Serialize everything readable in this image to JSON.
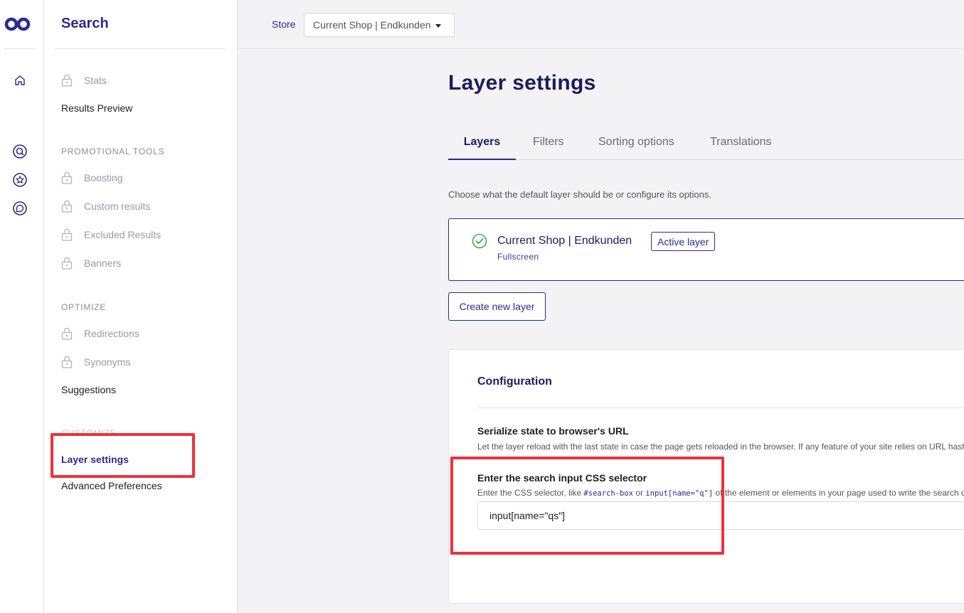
{
  "sidebar": {
    "title": "Search",
    "sections": {
      "promotional_tools": "PROMOTIONAL TOOLS",
      "optimize": "OPTIMIZE",
      "customize": "CUSTOMIZE"
    },
    "items": [
      {
        "label": "Stats",
        "locked": true
      },
      {
        "label": "Results Preview",
        "locked": false
      },
      {
        "label": "Boosting",
        "locked": true
      },
      {
        "label": "Custom results",
        "locked": true
      },
      {
        "label": "Excluded Results",
        "locked": true
      },
      {
        "label": "Banners",
        "locked": true
      },
      {
        "label": "Redirections",
        "locked": true
      },
      {
        "label": "Synonyms",
        "locked": true
      },
      {
        "label": "Suggestions",
        "locked": false
      },
      {
        "label": "Layer settings",
        "locked": false,
        "active": true
      },
      {
        "label": "Advanced Preferences",
        "locked": false
      }
    ]
  },
  "topbar": {
    "store_label": "Store",
    "store_value": "Current Shop | Endkunden"
  },
  "main": {
    "title": "Layer settings",
    "tabs": [
      {
        "label": "Layers",
        "active": true
      },
      {
        "label": "Filters"
      },
      {
        "label": "Sorting options"
      },
      {
        "label": "Translations"
      }
    ],
    "intro": "Choose what the default layer should be or configure its options.",
    "layer": {
      "name": "Current Shop | Endkunden",
      "type": "Fullscreen",
      "badge": "Active layer"
    },
    "create_button": "Create new layer",
    "configuration": {
      "title": "Configuration",
      "serialize": {
        "title": "Serialize state to browser's URL",
        "help": "Let the layer reload with the last state in case the page gets reloaded in the browser. If any feature of your site relies on URL hashes"
      },
      "selector": {
        "title": "Enter the search input CSS selector",
        "help_prefix": "Enter the CSS selector, like",
        "example_1": "#search-box",
        "help_or": "or",
        "example_2": "input[name=\"q\"]",
        "help_suffix": "of the element or elements in your page used to write the search query",
        "value": "input[name=\"qs\"]"
      }
    }
  },
  "colors": {
    "brand": "#2d2a8c",
    "highlight": "#f0303e",
    "success": "#3fae49"
  }
}
